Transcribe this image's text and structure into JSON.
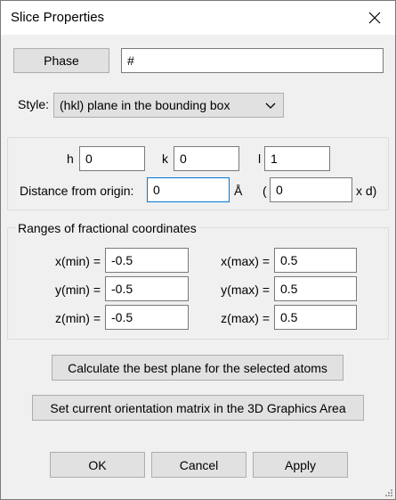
{
  "window": {
    "title": "Slice Properties"
  },
  "phase": {
    "button_label": "Phase",
    "value": "#"
  },
  "style": {
    "label": "Style:",
    "selected": "(hkl) plane in the bounding box"
  },
  "plane": {
    "h_label": "h",
    "h_value": "0",
    "k_label": "k",
    "k_value": "0",
    "l_label": "l",
    "l_value": "1",
    "distance_label": "Distance from origin:",
    "distance_value": "0",
    "distance_unit": "Å",
    "paren_open": "(",
    "multiplier_value": "0",
    "multiplier_unit": "x d)"
  },
  "ranges": {
    "title": "Ranges of fractional coordinates",
    "xmin_label": "x(min) =",
    "xmin_value": "-0.5",
    "ymin_label": "y(min) =",
    "ymin_value": "-0.5",
    "zmin_label": "z(min) =",
    "zmin_value": "-0.5",
    "xmax_label": "x(max) =",
    "xmax_value": "0.5",
    "ymax_label": "y(max) =",
    "ymax_value": "0.5",
    "zmax_label": "z(max) =",
    "zmax_value": "0.5"
  },
  "actions": {
    "best_plane_label": "Calculate the best plane for the selected atoms",
    "orientation_label": "Set current orientation matrix in the 3D Graphics Area"
  },
  "footer": {
    "ok_label": "OK",
    "cancel_label": "Cancel",
    "apply_label": "Apply"
  },
  "icons": {
    "close": "close-icon",
    "dropdown": "chevron-down-icon",
    "resize": "resize-grip-icon"
  }
}
